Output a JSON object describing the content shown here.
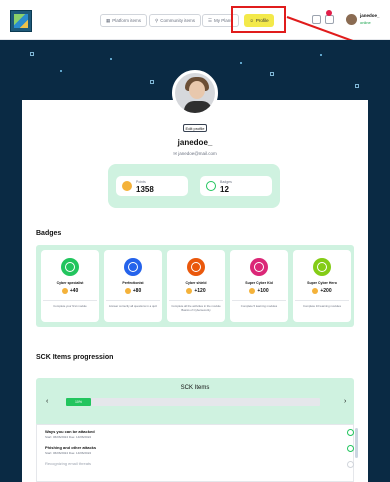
{
  "nav": {
    "platform_items": "Platform items",
    "community_items": "Community items",
    "my_plans": "My Plans",
    "profile": "Profile",
    "smalltext": "en",
    "user_name": "janedoe_",
    "user_status": "online"
  },
  "profile": {
    "edit_label": "Edit profile",
    "username": "janedoe_",
    "email": "janedoe@mail.com",
    "stats": [
      {
        "label": "Points",
        "value": "1358",
        "icon": "coin-icon"
      },
      {
        "label": "Badges",
        "value": "12",
        "icon": "badge-icon"
      }
    ]
  },
  "badges": {
    "title": "Badges",
    "items": [
      {
        "name": "Cyber specialist",
        "points": "+40",
        "desc": "Complete your first module",
        "color": "#22c55e"
      },
      {
        "name": "Perfectionist",
        "points": "+80",
        "desc": "Answer correctly all questions in a quiz",
        "color": "#2563eb"
      },
      {
        "name": "Cyber shield",
        "points": "+120",
        "desc": "Complete all the activities in the module Basics of Cybersecurity",
        "color": "#ea580c"
      },
      {
        "name": "Super Cyber Kid",
        "points": "+100",
        "desc": "Complete 5 learning modules",
        "color": "#db2777"
      },
      {
        "name": "Super Cyber Hero",
        "points": "+200",
        "desc": "Complete 10 learning modules",
        "color": "#84cc16"
      }
    ]
  },
  "sck": {
    "section_title": "SCK Items progression",
    "box_title": "SCK Items",
    "progress_label": "10%",
    "progress": 0.1,
    "items": [
      {
        "title": "Ways you can be attacked",
        "dates": "Start: 06/06/2024   Due: 14/06/2024"
      },
      {
        "title": "Phishing and other attacks",
        "dates": "Start: 06/06/2024   Due: 14/06/2024"
      },
      {
        "title": "Recognizing email threats",
        "dates": ""
      }
    ]
  },
  "colors": {
    "accent": "#22c55e",
    "hero": "#0a2a44",
    "panel": "#cff2e0",
    "highlight": "#e01c1c"
  }
}
